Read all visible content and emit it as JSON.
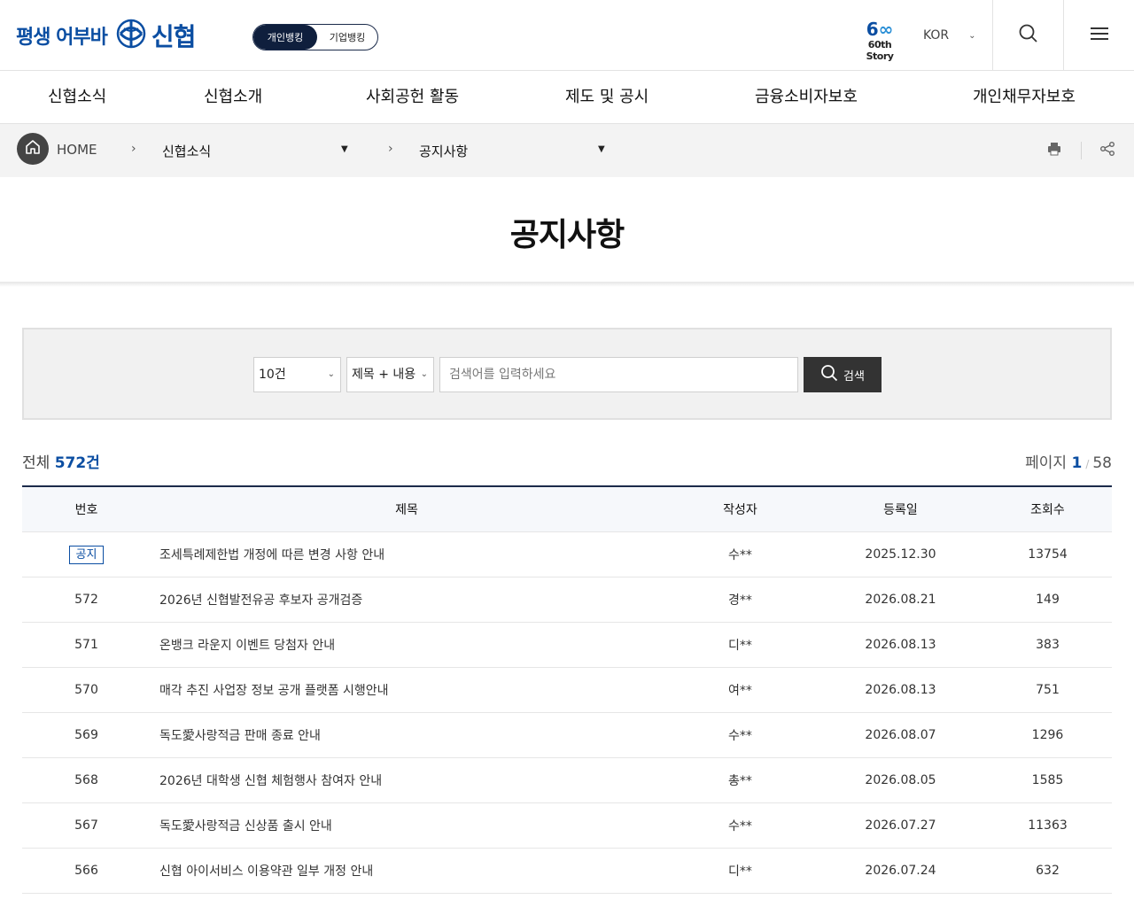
{
  "header": {
    "slogan": "평생 어부바",
    "brand": "신협",
    "toggle_personal": "개인뱅킹",
    "toggle_business": "기업뱅킹",
    "story_line": "60th Story",
    "lang": "KOR"
  },
  "gnb": [
    "신협소식",
    "신협소개",
    "사회공헌 활동",
    "제도 및 공시",
    "금융소비자보호",
    "개인채무자보호"
  ],
  "breadcrumb": {
    "home": "HOME",
    "level1": "신협소식",
    "level2": "공지사항"
  },
  "page": {
    "title": "공지사항"
  },
  "search": {
    "count_option": "10건",
    "field_option": "제목 + 내용",
    "placeholder": "검색어를 입력하세요",
    "button": "검색"
  },
  "summary": {
    "total_label": "전체",
    "total_count": "572건",
    "page_label": "페이지",
    "current_page": "1",
    "total_pages": "58"
  },
  "table": {
    "headers": {
      "no": "번호",
      "title": "제목",
      "writer": "작성자",
      "date": "등록일",
      "views": "조회수"
    },
    "rows": [
      {
        "no": "공지",
        "title": "조세특례제한법 개정에 따른 변경 사항 안내",
        "writer": "수**",
        "date": "2025.12.30",
        "views": "13754"
      },
      {
        "no": "572",
        "title": "2026년 신협발전유공 후보자 공개검증",
        "writer": "경**",
        "date": "2026.08.21",
        "views": "149"
      },
      {
        "no": "571",
        "title": "온뱅크 라운지 이벤트 당첨자 안내",
        "writer": "디**",
        "date": "2026.08.13",
        "views": "383"
      },
      {
        "no": "570",
        "title": "매각 추진 사업장 정보 공개 플랫폼 시행안내",
        "writer": "여**",
        "date": "2026.08.13",
        "views": "751"
      },
      {
        "no": "569",
        "title": "독도愛사랑적금 판매 종료 안내",
        "writer": "수**",
        "date": "2026.08.07",
        "views": "1296"
      },
      {
        "no": "568",
        "title": "2026년 대학생 신협 체험행사 참여자 안내",
        "writer": "총**",
        "date": "2026.08.05",
        "views": "1585"
      },
      {
        "no": "567",
        "title": "독도愛사랑적금 신상품 출시 안내",
        "writer": "수**",
        "date": "2026.07.27",
        "views": "11363"
      },
      {
        "no": "566",
        "title": "신협 아이서비스 이용약관 일부 개정 안내",
        "writer": "디**",
        "date": "2026.07.24",
        "views": "632"
      }
    ]
  },
  "colors": {
    "brand": "#0b4ea2",
    "navy": "#0f1f3d",
    "search_button": "#333333"
  },
  "icons": {
    "logo": "shinhyup-logo-icon",
    "search": "search-icon",
    "menu": "hamburger-menu-icon",
    "home": "home-icon",
    "print": "print-icon",
    "share": "share-icon"
  }
}
